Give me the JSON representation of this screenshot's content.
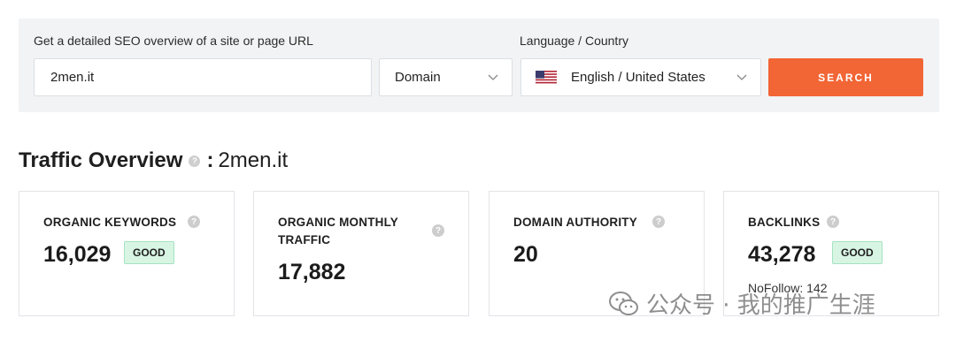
{
  "search": {
    "url_label": "Get a detailed SEO overview of a site or page URL",
    "lang_label": "Language / Country",
    "url_value": "2men.it",
    "type_value": "Domain",
    "lang_value": "English / United States",
    "button_label": "SEARCH",
    "accent": "#f26535"
  },
  "overview": {
    "title": "Traffic Overview",
    "colon": ":",
    "domain": "2men.it"
  },
  "cards": {
    "keywords": {
      "title": "ORGANIC KEYWORDS",
      "value": "16,029",
      "badge": "GOOD"
    },
    "traffic": {
      "title_line1": "ORGANIC MONTHLY",
      "title_line2": "TRAFFIC",
      "value": "17,882"
    },
    "authority": {
      "title": "DOMAIN AUTHORITY",
      "value": "20"
    },
    "backlinks": {
      "title": "BACKLINKS",
      "value": "43,278",
      "badge": "GOOD",
      "nofollow": "NoFollow: 142"
    }
  },
  "watermark": {
    "text": "公众号 · 我的推广生涯"
  },
  "icons": [
    "chevron-down-icon",
    "us-flag-icon",
    "help-icon",
    "wechat-icon"
  ],
  "colors": {
    "badge_good_bg": "#d8f5e4",
    "panel_bg": "#f2f3f5"
  }
}
